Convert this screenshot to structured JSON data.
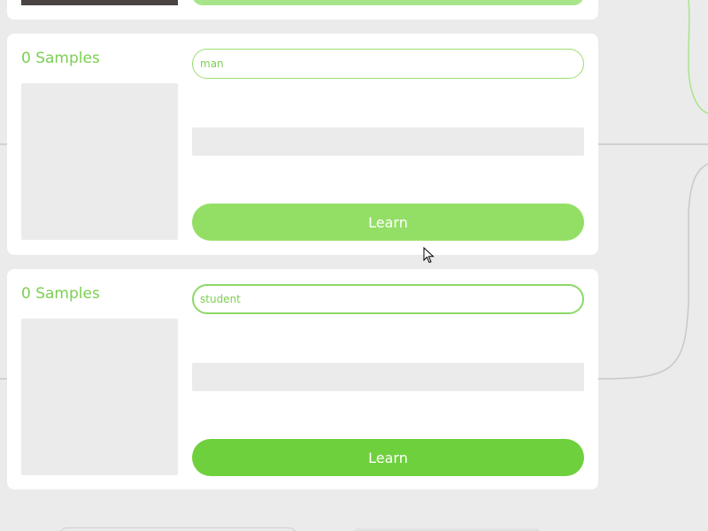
{
  "cards": [
    {
      "sample_count": "0 Samples",
      "label_value": "man",
      "learn_label": "Learn"
    },
    {
      "sample_count": "0 Samples",
      "label_value": "student",
      "learn_label": "Learn"
    }
  ],
  "colors": {
    "accent": "#7ccf52",
    "button_light": "#93df66",
    "button_dark": "#6fd03e",
    "background": "#ebebeb"
  },
  "icons": {
    "cursor": "mouse-pointer-icon"
  }
}
